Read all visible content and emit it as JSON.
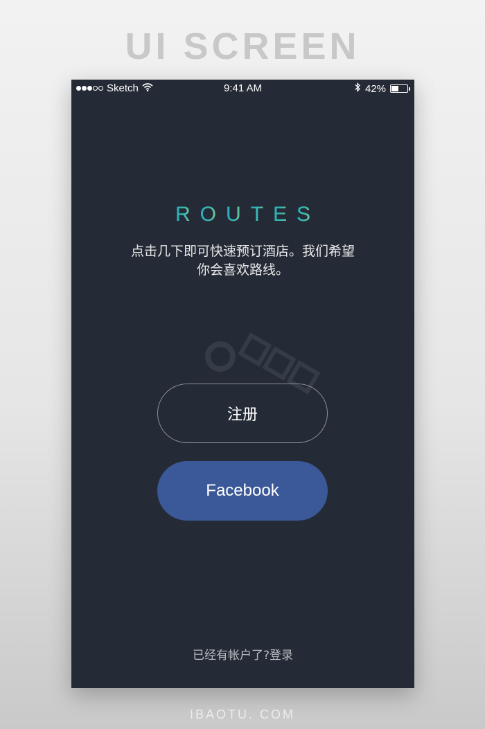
{
  "page": {
    "header": "UI SCREEN",
    "footer": "IBAOTU. COM"
  },
  "status_bar": {
    "carrier": "Sketch",
    "signal_full_dots": 3,
    "signal_empty_dots": 2,
    "time": "9:41 AM",
    "battery_percent": "42%",
    "battery_level": 0.42
  },
  "app": {
    "logo_letters": [
      "R",
      "O",
      "U",
      "T",
      "E",
      "S"
    ],
    "tagline_line1": "点击几下即可快速预订酒店。我们希望",
    "tagline_line2": "你会喜欢路线。",
    "register_label": "注册",
    "facebook_label": "Facebook",
    "login_prompt": "已经有帐户了?登录"
  },
  "colors": {
    "screen_bg": "#252b36",
    "facebook_blue": "#3b5998",
    "logo_gradient_start": "#23aebf",
    "logo_gradient_end": "#c8dd7a"
  },
  "icons": {
    "wifi": "wifi-icon",
    "bluetooth": "bluetooth-icon",
    "battery": "battery-icon"
  }
}
